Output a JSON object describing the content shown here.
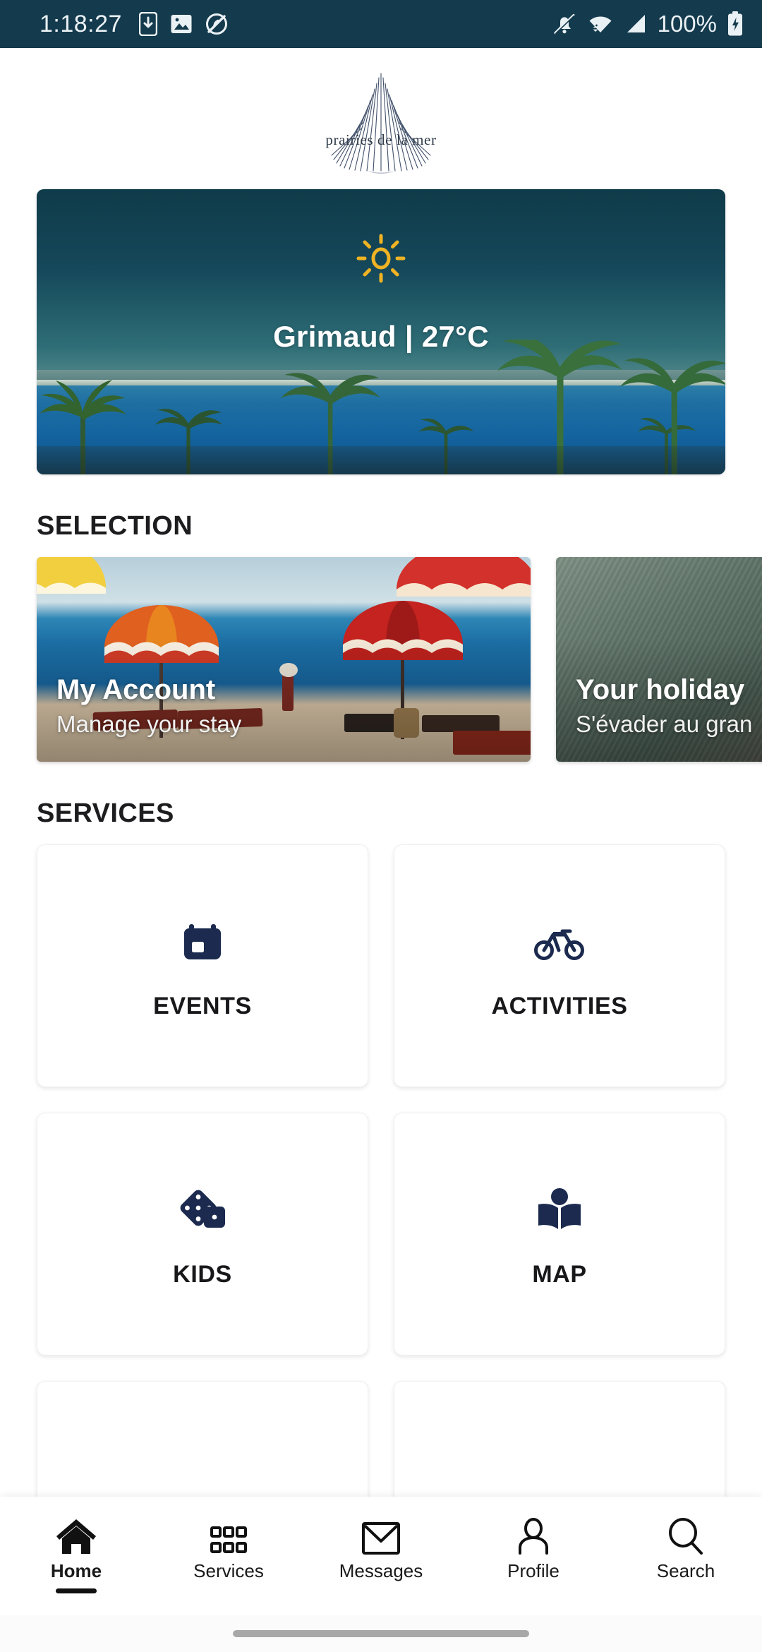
{
  "status_bar": {
    "time": "1:18:27",
    "battery_text": "100%",
    "icons": [
      "phone-download-icon",
      "image-icon",
      "do-not-disturb-icon",
      "bell-off-icon",
      "wifi-icon",
      "cellular-signal-icon",
      "battery-charging-icon"
    ],
    "background_color": "#143a4d"
  },
  "brand": {
    "logo_name": "prairies-de-la-mer-logo",
    "wordmark": "prairies de la mer"
  },
  "weather_card": {
    "name": "weather-card",
    "icon": "sun-icon",
    "icon_color": "#f0b323",
    "location": "Grimaud",
    "separator": "|",
    "temperature": "27°C",
    "label": "Grimaud | 27°C"
  },
  "selection": {
    "title": "SELECTION",
    "cards": [
      {
        "title": "My Account",
        "subtitle": "Manage your stay",
        "image": "beach-umbrellas-photo"
      },
      {
        "title": "Your holiday",
        "subtitle": "S'évader au gran",
        "image": "green-leaf-photo"
      }
    ]
  },
  "services": {
    "title": "SERVICES",
    "icon_color": "#1b2a4e",
    "tiles": [
      {
        "label": "EVENTS",
        "icon": "calendar-icon"
      },
      {
        "label": "ACTIVITIES",
        "icon": "bicycle-icon"
      },
      {
        "label": "KIDS",
        "icon": "dice-icon"
      },
      {
        "label": "MAP",
        "icon": "open-book-icon"
      }
    ]
  },
  "bottom_nav": {
    "items": [
      {
        "label": "Home",
        "icon": "home-icon",
        "active": true
      },
      {
        "label": "Services",
        "icon": "grid-dots-icon",
        "active": false
      },
      {
        "label": "Messages",
        "icon": "envelope-icon",
        "active": false
      },
      {
        "label": "Profile",
        "icon": "person-icon",
        "active": false
      },
      {
        "label": "Search",
        "icon": "magnifier-icon",
        "active": false
      }
    ]
  }
}
